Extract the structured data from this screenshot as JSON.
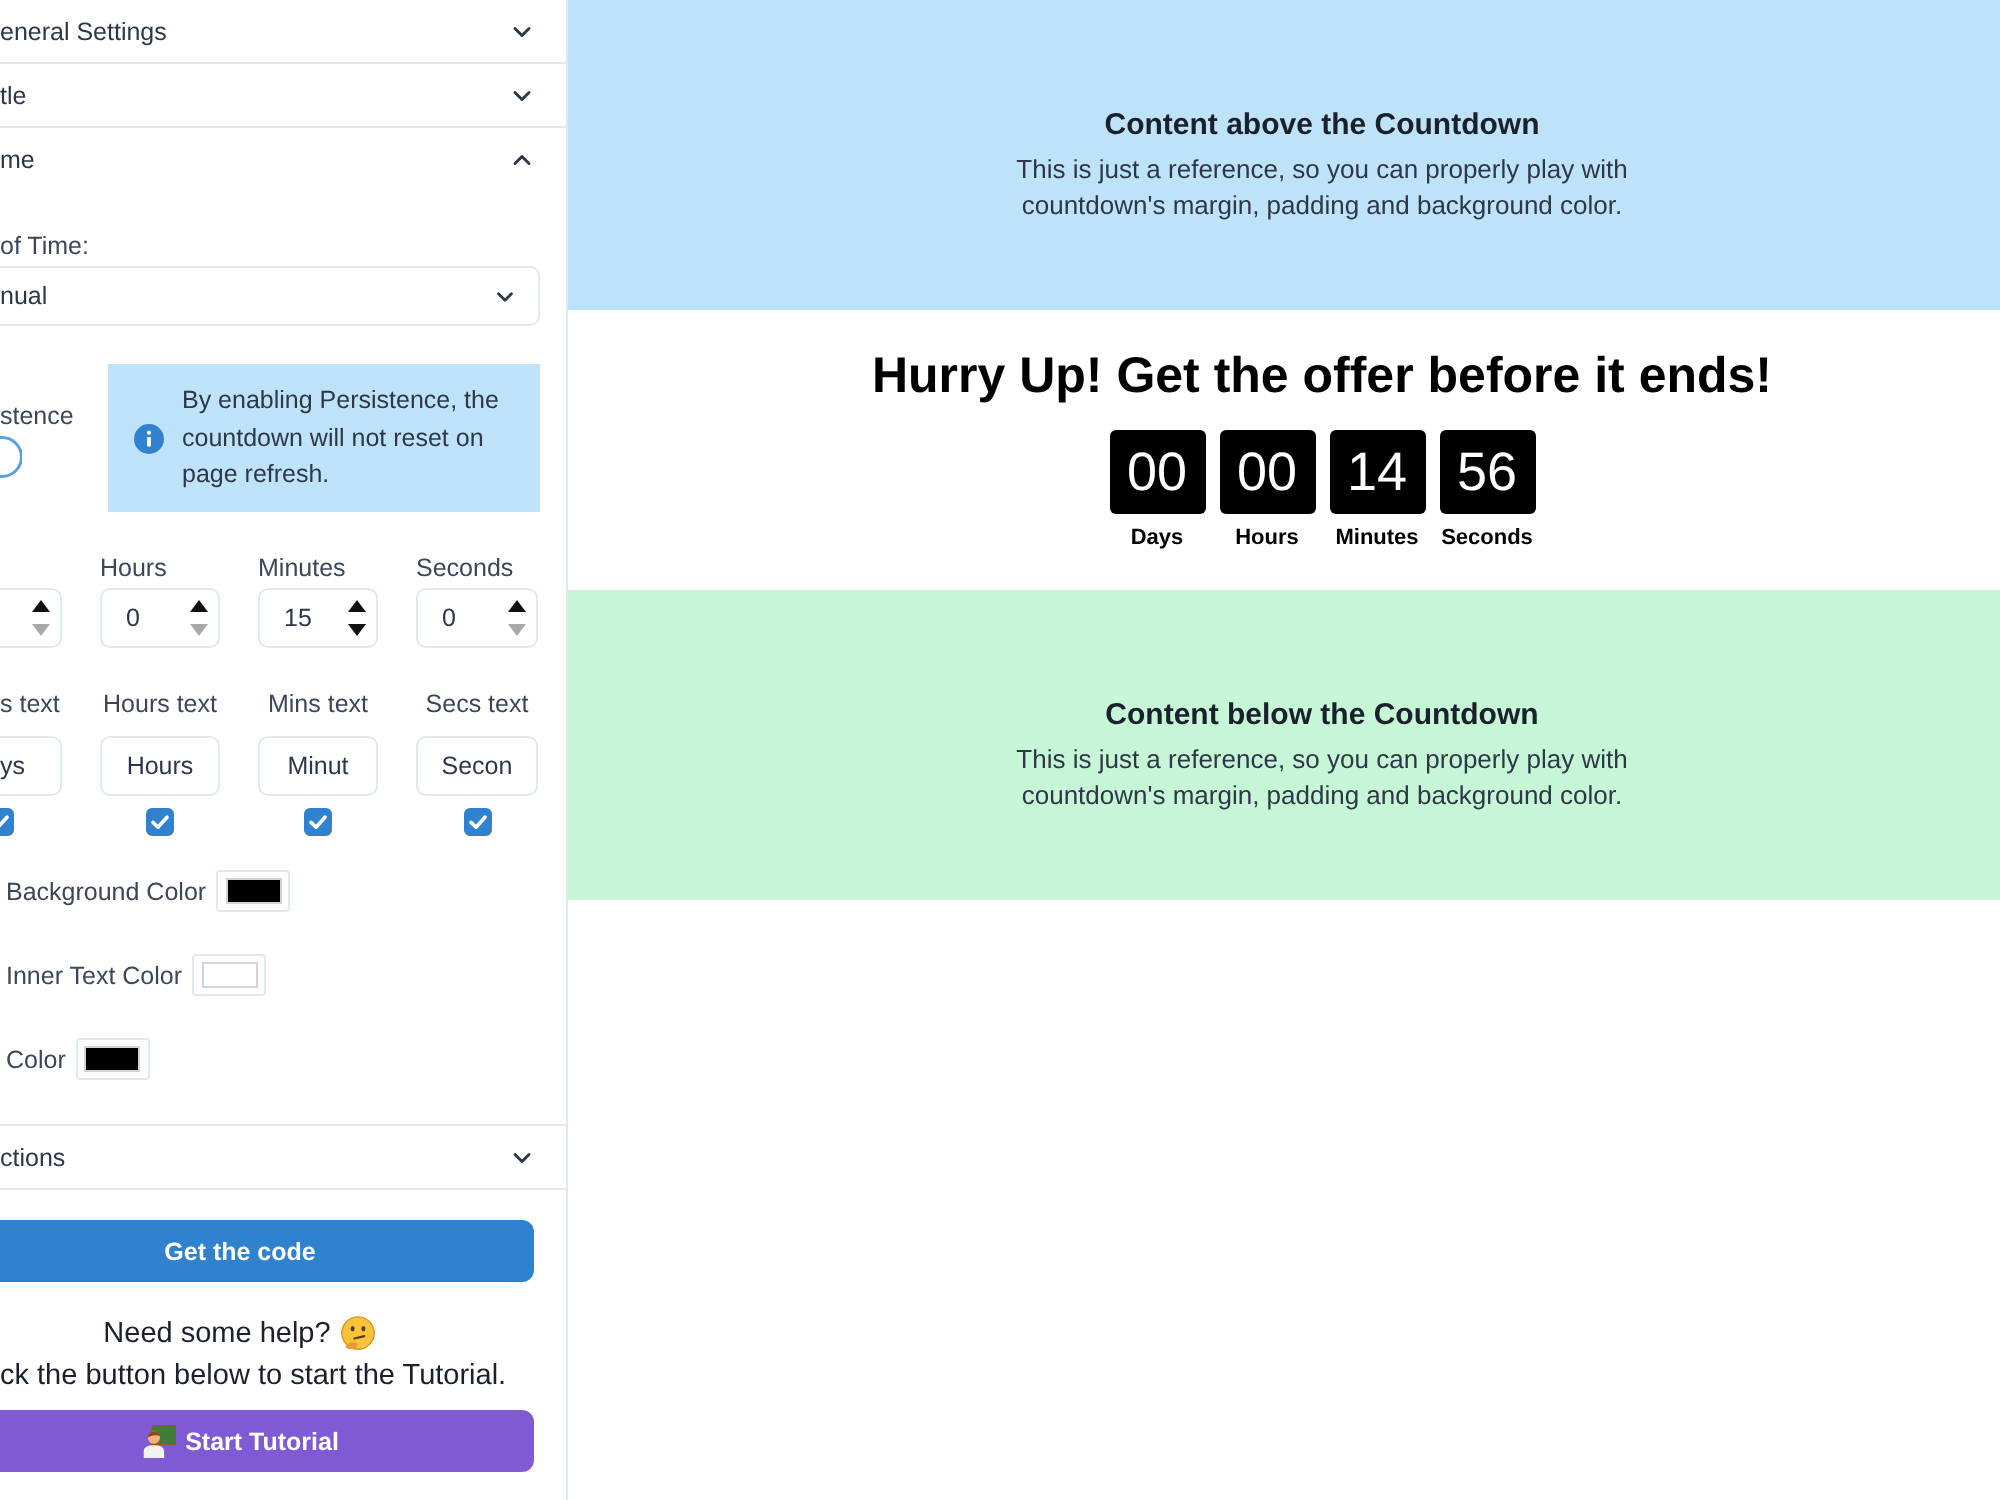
{
  "sidebar": {
    "sections": [
      {
        "title": "eneral Settings",
        "expanded": false
      },
      {
        "title": "tle",
        "expanded": false
      },
      {
        "title": "me",
        "expanded": true,
        "time_type": {
          "label": "of Time:",
          "value": "nual"
        },
        "persistence": {
          "label": "stence",
          "on": false,
          "note_lines": [
            "By enabling Persistence, the",
            "countdown will not reset on",
            "page refresh."
          ]
        },
        "durations": [
          {
            "decrement_disabled": true
          },
          {
            "label": "Hours",
            "value": "0",
            "decrement_disabled": true
          },
          {
            "label": "Minutes",
            "value": "15",
            "decrement_disabled": false
          },
          {
            "label": "Seconds",
            "value": "0",
            "decrement_disabled": true
          }
        ],
        "unit_texts": [
          {
            "label": "s text",
            "value": "ys",
            "checked": true
          },
          {
            "label": "Hours text",
            "value": "Hours",
            "checked": true
          },
          {
            "label": "Mins text",
            "value": "Minut",
            "checked": true
          },
          {
            "label": "Secs text",
            "value": "Secon",
            "checked": true
          }
        ],
        "colors": [
          {
            "label": "Background Color",
            "color": "#000000"
          },
          {
            "label": "Inner Text Color",
            "color": "#ffffff"
          },
          {
            "label": "Color",
            "color": "#000000"
          }
        ]
      },
      {
        "title": "ctions",
        "expanded": false
      }
    ],
    "get_code_button": "Get the code",
    "help": {
      "heading": "Need some help?",
      "text": "ck the button below to start the Tutorial.",
      "button": "Start Tutorial"
    }
  },
  "preview": {
    "above": {
      "title": "Content above the Countdown",
      "text_lines": [
        "This is just a reference, so you can properly play with",
        "countdown's margin, padding and background color."
      ]
    },
    "countdown": {
      "heading": "Hurry Up! Get the offer before it ends!",
      "units": [
        {
          "value": "00",
          "label": "Days"
        },
        {
          "value": "00",
          "label": "Hours"
        },
        {
          "value": "14",
          "label": "Minutes"
        },
        {
          "value": "56",
          "label": "Seconds"
        }
      ]
    },
    "below": {
      "title": "Content below the Countdown",
      "text_lines": [
        "This is just a reference, so you can properly play with",
        "countdown's margin, padding and background color."
      ]
    }
  }
}
